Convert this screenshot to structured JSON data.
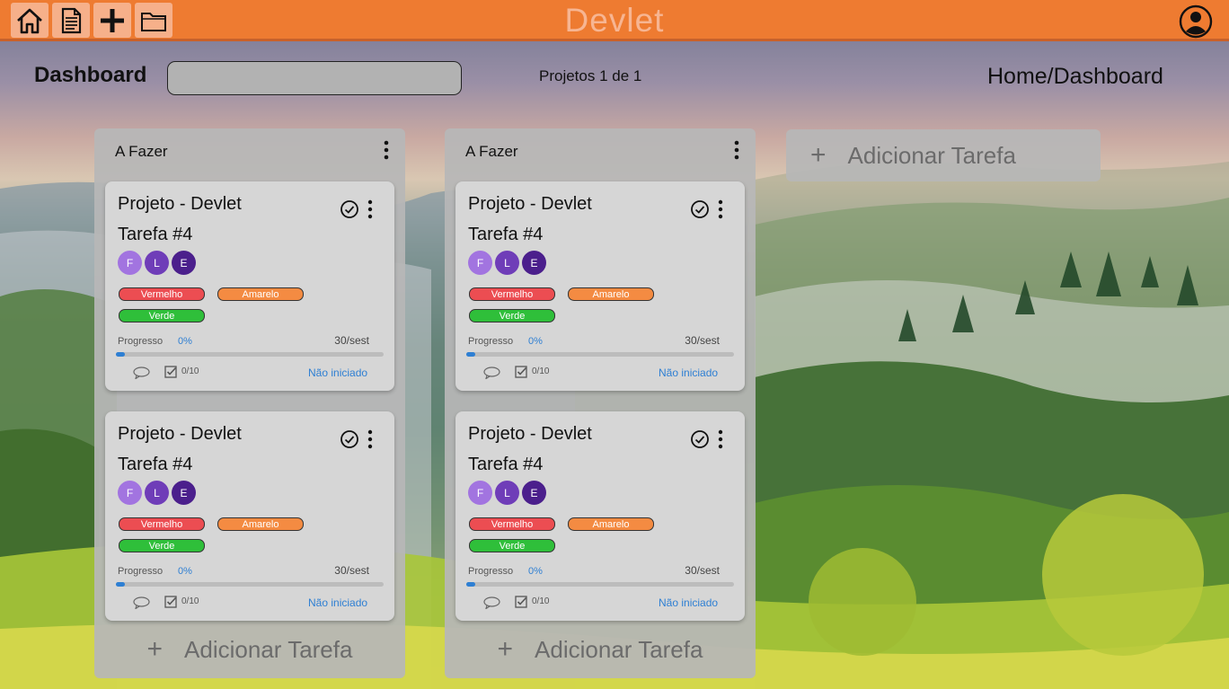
{
  "app": {
    "brand": "Devlet"
  },
  "topbar": {
    "buttons": [
      {
        "name": "home-button",
        "icon": "home-icon"
      },
      {
        "name": "document-button",
        "icon": "document-icon"
      },
      {
        "name": "add-button",
        "icon": "plus-icon"
      },
      {
        "name": "folder-button",
        "icon": "folder-icon"
      }
    ],
    "user_icon": "user-icon"
  },
  "header": {
    "title": "Dashboard",
    "search_value": "",
    "projects_label": "Projetos 1 de 1",
    "breadcrumb": "Home/Dashboard"
  },
  "columns": [
    {
      "title": "A Fazer",
      "add_label": "Adicionar Tarefa",
      "cards": [
        {
          "project": "Projeto - Devlet",
          "task": "Tarefa #4",
          "members": [
            "F",
            "L",
            "E"
          ],
          "tags": [
            "Vermelho",
            "Amarelo",
            "Verde"
          ],
          "progress_label": "Progresso",
          "progress_pct": "0%",
          "progress": 0,
          "date": "30/sest",
          "checklist": "0/10",
          "status": "Não iniciado"
        },
        {
          "project": "Projeto - Devlet",
          "task": "Tarefa #4",
          "members": [
            "F",
            "L",
            "E"
          ],
          "tags": [
            "Vermelho",
            "Amarelo",
            "Verde"
          ],
          "progress_label": "Progresso",
          "progress_pct": "0%",
          "progress": 0,
          "date": "30/sest",
          "checklist": "0/10",
          "status": "Não iniciado"
        }
      ]
    },
    {
      "title": "A Fazer",
      "add_label": "Adicionar Tarefa",
      "cards": [
        {
          "project": "Projeto - Devlet",
          "task": "Tarefa #4",
          "members": [
            "F",
            "L",
            "E"
          ],
          "tags": [
            "Vermelho",
            "Amarelo",
            "Verde"
          ],
          "progress_label": "Progresso",
          "progress_pct": "0%",
          "progress": 0,
          "date": "30/sest",
          "checklist": "0/10",
          "status": "Não iniciado"
        },
        {
          "project": "Projeto - Devlet",
          "task": "Tarefa #4",
          "members": [
            "F",
            "L",
            "E"
          ],
          "tags": [
            "Vermelho",
            "Amarelo",
            "Verde"
          ],
          "progress_label": "Progresso",
          "progress_pct": "0%",
          "progress": 0,
          "date": "30/sest",
          "checklist": "0/10",
          "status": "Não iniciado"
        }
      ]
    }
  ],
  "add_column": {
    "label": "Adicionar Tarefa"
  },
  "colors": {
    "topbar": "#ee7b31",
    "accent_blue": "#2e7fd3",
    "tag_red": "#ec4d52",
    "tag_orange": "#f48b42",
    "tag_green": "#2fbf3a",
    "avatar_f": "#a274e0",
    "avatar_l": "#6f3db8",
    "avatar_e": "#4b1f8c"
  }
}
